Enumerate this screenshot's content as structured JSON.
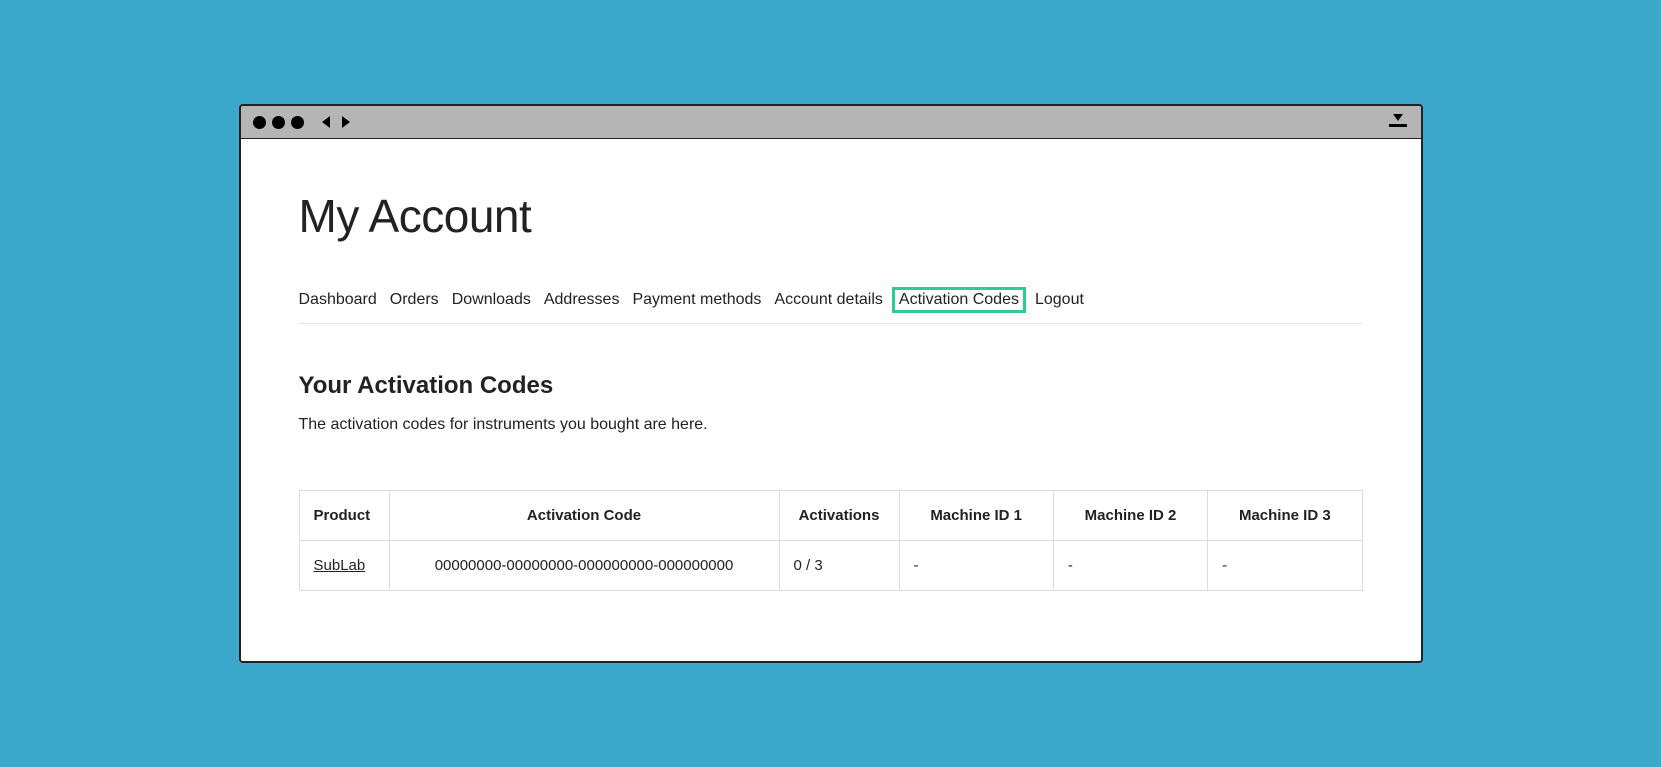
{
  "page": {
    "title": "My Account"
  },
  "nav": {
    "items": [
      {
        "label": "Dashboard",
        "highlighted": false
      },
      {
        "label": "Orders",
        "highlighted": false
      },
      {
        "label": "Downloads",
        "highlighted": false
      },
      {
        "label": "Addresses",
        "highlighted": false
      },
      {
        "label": "Payment methods",
        "highlighted": false
      },
      {
        "label": "Account details",
        "highlighted": false
      },
      {
        "label": "Activation Codes",
        "highlighted": true
      },
      {
        "label": "Logout",
        "highlighted": false
      }
    ]
  },
  "section": {
    "title": "Your Activation Codes",
    "description": "The activation codes for instruments you bought are here."
  },
  "table": {
    "headers": {
      "product": "Product",
      "code": "Activation Code",
      "activations": "Activations",
      "m1": "Machine ID 1",
      "m2": "Machine ID 2",
      "m3": "Machine ID 3"
    },
    "rows": [
      {
        "product": "SubLab",
        "code": "00000000-00000000-000000000-000000000",
        "activations": "0 / 3",
        "m1": "-",
        "m2": "-",
        "m3": "-"
      }
    ]
  }
}
